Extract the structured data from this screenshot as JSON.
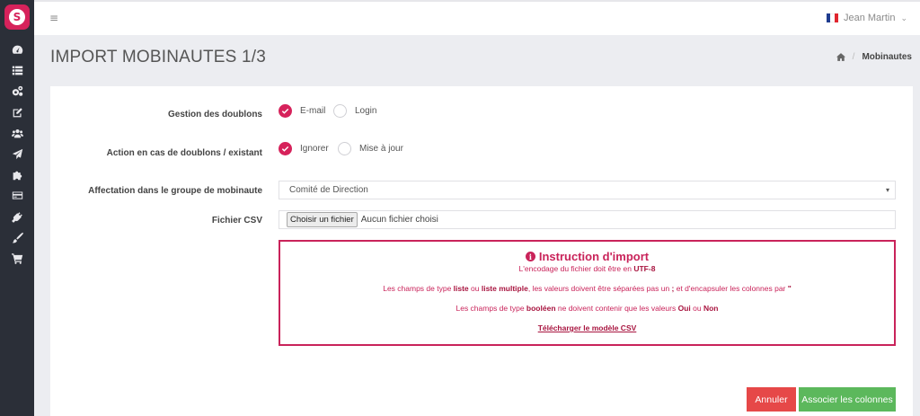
{
  "app": {
    "logo_letter": "S"
  },
  "colors": {
    "accent": "#d6225b",
    "sidebar_bg": "#2b2f38",
    "cancel": "#e64848",
    "confirm": "#5cb85c"
  },
  "sidebar": {
    "icons": [
      "dashboard-icon",
      "list-icon",
      "cogs-icon",
      "edit-icon",
      "users-icon",
      "paper-plane-icon",
      "puzzle-icon",
      "credit-card-icon",
      "plug-icon",
      "paint-brush-icon",
      "cart-icon"
    ]
  },
  "topbar": {
    "menu_glyph": "≡",
    "user_name": "Jean Martin",
    "user_chevron": "⌄"
  },
  "page": {
    "title": "IMPORT MOBINAUTES 1/3",
    "breadcrumb": {
      "current": "Mobinautes",
      "separator": "/"
    }
  },
  "form": {
    "doublons": {
      "label": "Gestion des doublons",
      "options": [
        {
          "label": "E-mail",
          "checked": true
        },
        {
          "label": "Login",
          "checked": false
        }
      ]
    },
    "action": {
      "label": "Action en cas de doublons / existant",
      "options": [
        {
          "label": "Ignorer",
          "checked": true
        },
        {
          "label": "Mise à jour",
          "checked": false
        }
      ]
    },
    "group": {
      "label": "Affectation dans le groupe de mobinaute",
      "value": "Comité de Direction",
      "arrow": "▾"
    },
    "csv": {
      "label": "Fichier CSV",
      "button": "Choisir un fichier",
      "status": "Aucun fichier choisi"
    }
  },
  "instructions": {
    "title": "Instruction d'import",
    "info_glyph": "i",
    "line1": {
      "a": "L'encodage du fichier doit être en ",
      "b": "UTF-8"
    },
    "line2": {
      "a": "Les champs de type ",
      "b": "liste",
      "c": " ou ",
      "d": "liste multiple",
      "e": ", les valeurs doivent être séparées pas un ",
      "f": ";",
      "g": " et d'encapsuler les colonnes par ",
      "h": "\""
    },
    "line3": {
      "a": "Les champs de type ",
      "b": "booléen",
      "c": " ne doivent contenir que les valeurs ",
      "d": "Oui",
      "e": " ou ",
      "f": "Non"
    },
    "download": "Télécharger le modèle CSV"
  },
  "actions": {
    "cancel": "Annuler",
    "associate": "Associer les colonnes"
  }
}
